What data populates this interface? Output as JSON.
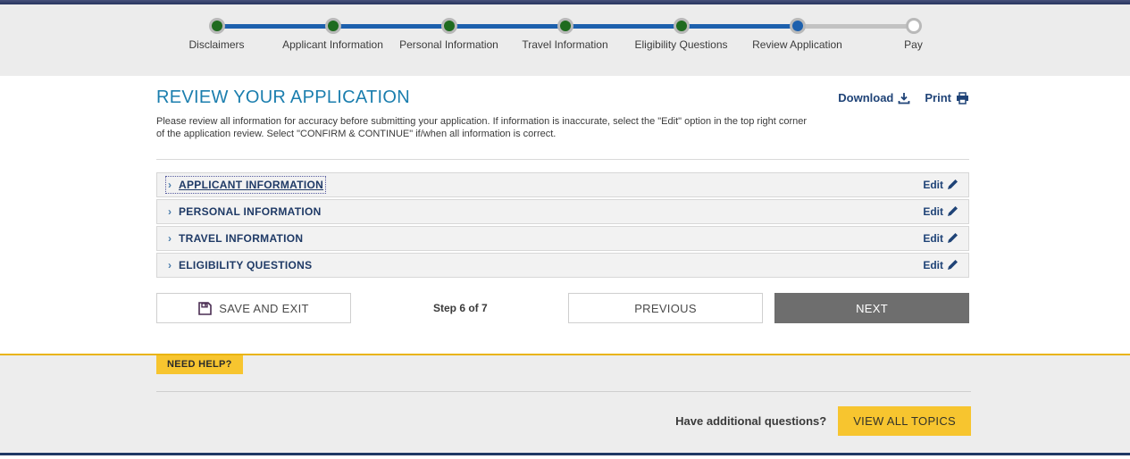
{
  "stepper": {
    "steps": [
      {
        "label": "Disclaimers",
        "state": "completed"
      },
      {
        "label": "Applicant Information",
        "state": "completed"
      },
      {
        "label": "Personal Information",
        "state": "completed"
      },
      {
        "label": "Travel Information",
        "state": "completed"
      },
      {
        "label": "Eligibility Questions",
        "state": "completed"
      },
      {
        "label": "Review Application",
        "state": "current"
      },
      {
        "label": "Pay",
        "state": "upcoming"
      }
    ]
  },
  "header": {
    "title": "REVIEW YOUR APPLICATION",
    "download_label": "Download",
    "print_label": "Print",
    "intro": "Please review all information for accuracy before submitting your application. If information is inaccurate, select the \"Edit\" option in the top right corner of the application review. Select \"CONFIRM & CONTINUE\" if/when all information is correct."
  },
  "sections": [
    {
      "label": "APPLICANT INFORMATION",
      "edit_label": "Edit"
    },
    {
      "label": "PERSONAL INFORMATION",
      "edit_label": "Edit"
    },
    {
      "label": "TRAVEL INFORMATION",
      "edit_label": "Edit"
    },
    {
      "label": "ELIGIBILITY QUESTIONS",
      "edit_label": "Edit"
    }
  ],
  "actions": {
    "save_exit_label": "SAVE AND EXIT",
    "step_indicator": "Step 6 of 7",
    "previous_label": "PREVIOUS",
    "next_label": "NEXT"
  },
  "footer": {
    "need_help_label": "NEED HELP?",
    "questions_text": "Have additional questions?",
    "view_all_topics_label": "VIEW ALL TOPICS"
  },
  "colors": {
    "accent_yellow": "#F7C52F",
    "navy": "#1F3864",
    "link_navy": "#1F4377",
    "stepper_blue": "#1D60AD",
    "step_green": "#1F6B1F",
    "title_blue": "#1B7EAE",
    "next_button_gray": "#6E6E6E"
  }
}
